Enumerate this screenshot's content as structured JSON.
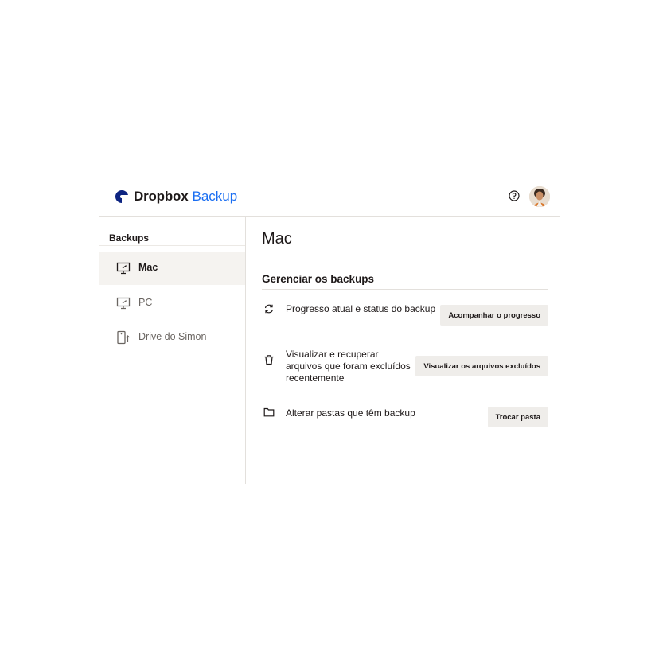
{
  "header": {
    "brand": "Dropbox",
    "product": "Backup",
    "brand_color": "#1e1919",
    "product_color": "#1a6ef2"
  },
  "sidebar": {
    "title": "Backups",
    "items": [
      {
        "label": "Mac",
        "icon": "monitor-icon",
        "active": true
      },
      {
        "label": "PC",
        "icon": "monitor-icon",
        "active": false
      },
      {
        "label": "Drive do Simon",
        "icon": "external-drive-icon",
        "active": false
      }
    ]
  },
  "main": {
    "title": "Mac",
    "section_title": "Gerenciar os backups",
    "rows": [
      {
        "icon": "sync-icon",
        "lines": [
          "Progresso atual e status do backup"
        ],
        "button": "Acompanhar o progresso"
      },
      {
        "icon": "trash-icon",
        "lines": [
          "Visualizar e recuperar",
          "arquivos que foram excluídos",
          "recentemente"
        ],
        "button": "Visualizar os arquivos excluídos"
      },
      {
        "icon": "folder-icon",
        "lines": [
          "Alterar pastas que têm backup"
        ],
        "button": "Trocar pasta"
      }
    ]
  }
}
